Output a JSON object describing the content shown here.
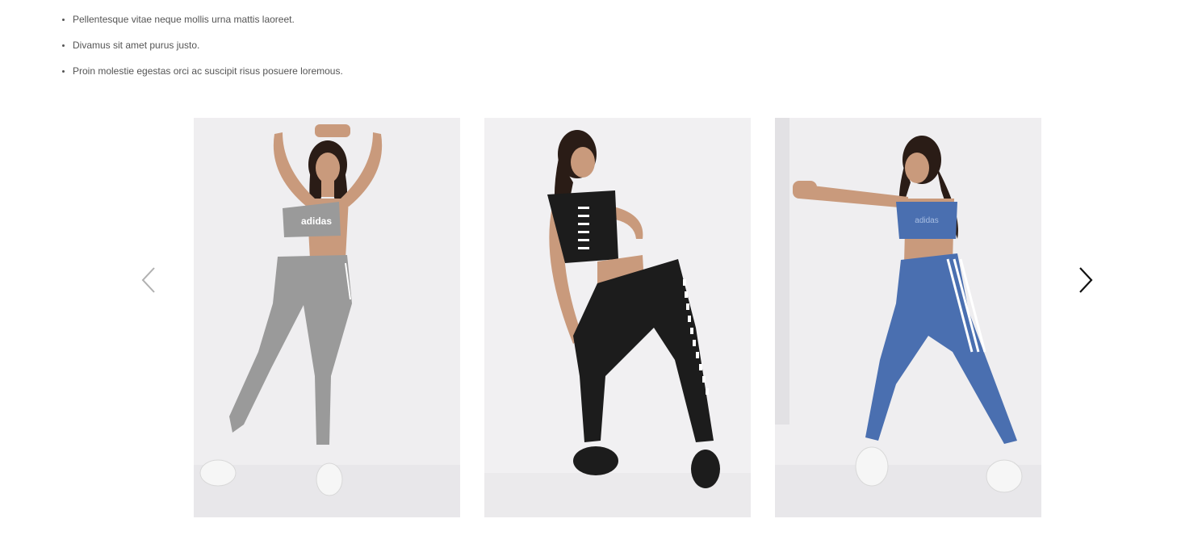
{
  "bullets": [
    "Pellentesque vitae neque mollis urna mattis laoreet.",
    "Divamus sit amet purus justo.",
    "Proin molestie egestas orci ac suscipit risus posuere loremous."
  ],
  "carousel": {
    "prev_icon": "chevron-left-icon",
    "next_icon": "chevron-right-icon",
    "slides": [
      {
        "outfit": "grey",
        "color": "#9a9a9a",
        "accent": "#ffffff"
      },
      {
        "outfit": "black",
        "color": "#1c1c1c",
        "accent": "#ffffff"
      },
      {
        "outfit": "blue",
        "color": "#4a6fb0",
        "accent": "#ffffff"
      }
    ]
  },
  "colors": {
    "text": "#555555",
    "photo_bg": "#efeef0",
    "skin": "#c99a7c",
    "hair": "#2a1c16",
    "arrow_prev": "#b0b0b0",
    "arrow_next": "#111111"
  }
}
